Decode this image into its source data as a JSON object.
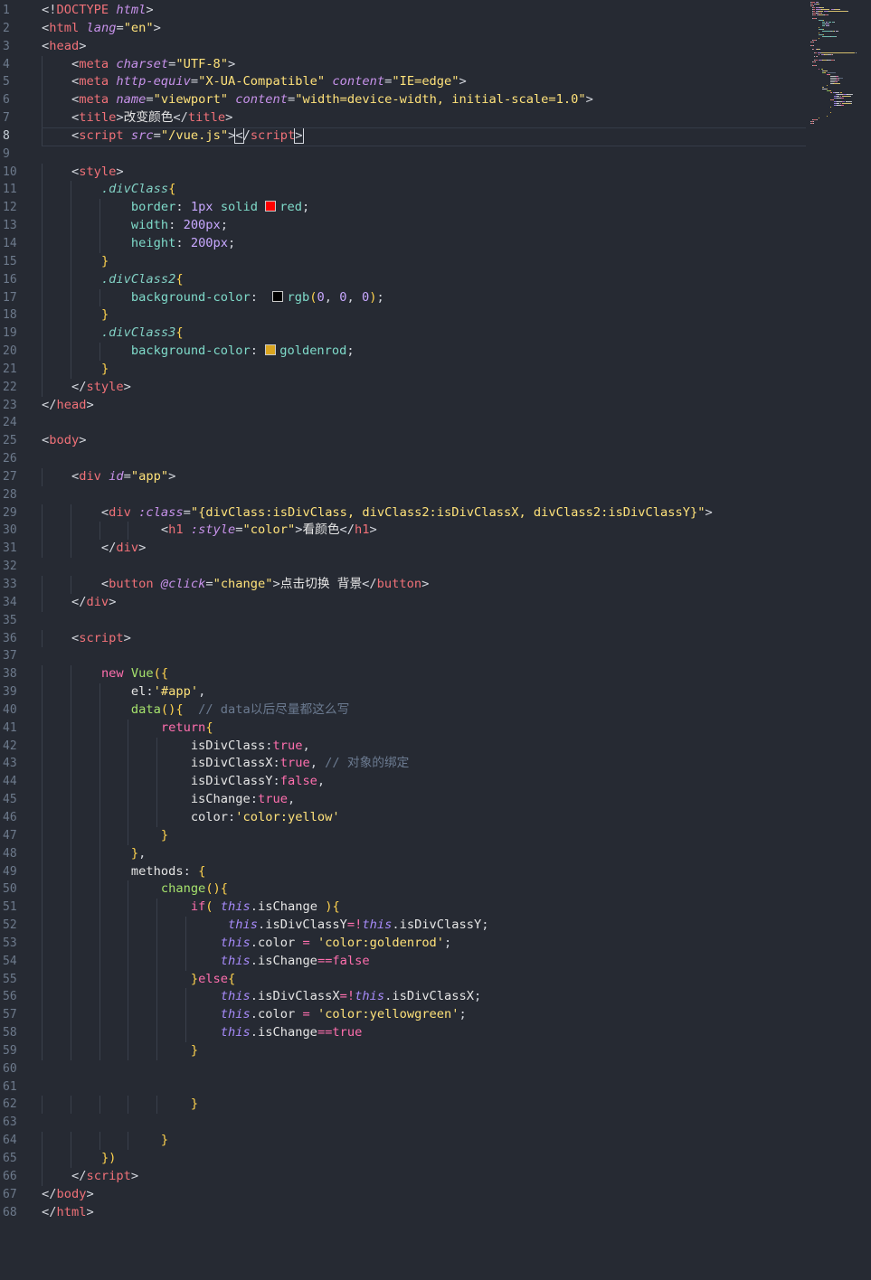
{
  "editor": {
    "active_line": 8,
    "colors": {
      "background": "#262a33",
      "red": "#ff0000",
      "black": "#000000",
      "goldenrod": "#daa520"
    },
    "lines": [
      [
        [
          "p",
          "<!"
        ],
        [
          "tag",
          "DOCTYPE"
        ],
        [
          "p",
          " "
        ],
        [
          "at",
          "html"
        ],
        [
          "p",
          ">"
        ]
      ],
      [
        [
          "p",
          "<"
        ],
        [
          "tag",
          "html"
        ],
        [
          "p",
          " "
        ],
        [
          "at",
          "lang"
        ],
        [
          "p",
          "="
        ],
        [
          "st",
          "\"en\""
        ],
        [
          "p",
          ">"
        ]
      ],
      [
        [
          "p",
          "<"
        ],
        [
          "tag",
          "head"
        ],
        [
          "p",
          ">"
        ]
      ],
      [
        [
          "p",
          "    <"
        ],
        [
          "tag",
          "meta"
        ],
        [
          "p",
          " "
        ],
        [
          "at",
          "charset"
        ],
        [
          "p",
          "="
        ],
        [
          "st",
          "\"UTF-8\""
        ],
        [
          "p",
          ">"
        ]
      ],
      [
        [
          "p",
          "    <"
        ],
        [
          "tag",
          "meta"
        ],
        [
          "p",
          " "
        ],
        [
          "at",
          "http-equiv"
        ],
        [
          "p",
          "="
        ],
        [
          "st",
          "\"X-UA-Compatible\""
        ],
        [
          "p",
          " "
        ],
        [
          "at",
          "content"
        ],
        [
          "p",
          "="
        ],
        [
          "st",
          "\"IE=edge\""
        ],
        [
          "p",
          ">"
        ]
      ],
      [
        [
          "p",
          "    <"
        ],
        [
          "tag",
          "meta"
        ],
        [
          "p",
          " "
        ],
        [
          "at",
          "name"
        ],
        [
          "p",
          "="
        ],
        [
          "st",
          "\"viewport\""
        ],
        [
          "p",
          " "
        ],
        [
          "at",
          "content"
        ],
        [
          "p",
          "="
        ],
        [
          "st",
          "\"width=device-width, initial-scale=1.0\""
        ],
        [
          "p",
          ">"
        ]
      ],
      [
        [
          "p",
          "    <"
        ],
        [
          "tag",
          "title"
        ],
        [
          "p",
          ">"
        ],
        [
          "id",
          "改变颜色"
        ],
        [
          "p",
          "</"
        ],
        [
          "tag",
          "title"
        ],
        [
          "p",
          ">"
        ]
      ],
      [
        [
          "p",
          "    <"
        ],
        [
          "tag",
          "script"
        ],
        [
          "p",
          " "
        ],
        [
          "at",
          "src"
        ],
        [
          "p",
          "="
        ],
        [
          "st",
          "\"/vue.js\""
        ],
        [
          "p",
          ">"
        ],
        [
          "p",
          "<"
        ],
        [
          "p",
          "/"
        ],
        [
          "tag",
          "script"
        ],
        [
          "p",
          ">"
        ]
      ],
      [],
      [
        [
          "p",
          "    <"
        ],
        [
          "tag",
          "style"
        ],
        [
          "p",
          ">"
        ]
      ],
      [
        [
          "p",
          "        "
        ],
        [
          "sel",
          ".divClass"
        ],
        [
          "br",
          "{"
        ]
      ],
      [
        [
          "p",
          "            "
        ],
        [
          "pr",
          "border"
        ],
        [
          "p",
          ": "
        ],
        [
          "num",
          "1px"
        ],
        [
          "p",
          " "
        ],
        [
          "pr",
          "solid"
        ],
        [
          "p",
          " "
        ],
        [
          "sw",
          "red"
        ],
        [
          "pr",
          "red"
        ],
        [
          "p",
          ";"
        ]
      ],
      [
        [
          "p",
          "            "
        ],
        [
          "pr",
          "width"
        ],
        [
          "p",
          ": "
        ],
        [
          "num",
          "200px"
        ],
        [
          "p",
          ";"
        ]
      ],
      [
        [
          "p",
          "            "
        ],
        [
          "pr",
          "height"
        ],
        [
          "p",
          ": "
        ],
        [
          "num",
          "200px"
        ],
        [
          "p",
          ";"
        ]
      ],
      [
        [
          "p",
          "        "
        ],
        [
          "br",
          "}"
        ]
      ],
      [
        [
          "p",
          "        "
        ],
        [
          "sel",
          ".divClass2"
        ],
        [
          "br",
          "{"
        ]
      ],
      [
        [
          "p",
          "            "
        ],
        [
          "pr",
          "background-color"
        ],
        [
          "p",
          ":  "
        ],
        [
          "sw",
          "black"
        ],
        [
          "pr",
          "rgb"
        ],
        [
          "br",
          "("
        ],
        [
          "num",
          "0"
        ],
        [
          "p",
          ", "
        ],
        [
          "num",
          "0"
        ],
        [
          "p",
          ", "
        ],
        [
          "num",
          "0"
        ],
        [
          "br",
          ")"
        ],
        [
          "p",
          ";"
        ]
      ],
      [
        [
          "p",
          "        "
        ],
        [
          "br",
          "}"
        ]
      ],
      [
        [
          "p",
          "        "
        ],
        [
          "sel",
          ".divClass3"
        ],
        [
          "br",
          "{"
        ]
      ],
      [
        [
          "p",
          "            "
        ],
        [
          "pr",
          "background-color"
        ],
        [
          "p",
          ": "
        ],
        [
          "sw",
          "goldenrod"
        ],
        [
          "pr",
          "goldenrod"
        ],
        [
          "p",
          ";"
        ]
      ],
      [
        [
          "p",
          "        "
        ],
        [
          "br",
          "}"
        ]
      ],
      [
        [
          "p",
          "    </"
        ],
        [
          "tag",
          "style"
        ],
        [
          "p",
          ">"
        ]
      ],
      [
        [
          "p",
          "</"
        ],
        [
          "tag",
          "head"
        ],
        [
          "p",
          ">"
        ]
      ],
      [],
      [
        [
          "p",
          "<"
        ],
        [
          "tag",
          "body"
        ],
        [
          "p",
          ">"
        ]
      ],
      [],
      [
        [
          "p",
          "    <"
        ],
        [
          "tag",
          "div"
        ],
        [
          "p",
          " "
        ],
        [
          "at",
          "id"
        ],
        [
          "p",
          "="
        ],
        [
          "st",
          "\"app\""
        ],
        [
          "p",
          ">"
        ]
      ],
      [],
      [
        [
          "p",
          "        <"
        ],
        [
          "tag",
          "div"
        ],
        [
          "p",
          " "
        ],
        [
          "at",
          ":class"
        ],
        [
          "p",
          "="
        ],
        [
          "st",
          "\"{divClass:isDivClass, divClass2:isDivClassX, divClass2:isDivClassY}\""
        ],
        [
          "p",
          ">"
        ]
      ],
      [
        [
          "p",
          "                <"
        ],
        [
          "tag",
          "h1"
        ],
        [
          "p",
          " "
        ],
        [
          "at",
          ":style"
        ],
        [
          "p",
          "="
        ],
        [
          "st",
          "\"color\""
        ],
        [
          "p",
          ">"
        ],
        [
          "id",
          "看颜色"
        ],
        [
          "p",
          "</"
        ],
        [
          "tag",
          "h1"
        ],
        [
          "p",
          ">"
        ]
      ],
      [
        [
          "p",
          "        </"
        ],
        [
          "tag",
          "div"
        ],
        [
          "p",
          ">"
        ]
      ],
      [],
      [
        [
          "p",
          "        <"
        ],
        [
          "tag",
          "button"
        ],
        [
          "p",
          " "
        ],
        [
          "at",
          "@click"
        ],
        [
          "p",
          "="
        ],
        [
          "st",
          "\"change\""
        ],
        [
          "p",
          ">"
        ],
        [
          "id",
          "点击切换 背景"
        ],
        [
          "p",
          "</"
        ],
        [
          "tag",
          "button"
        ],
        [
          "p",
          ">"
        ]
      ],
      [
        [
          "p",
          "    </"
        ],
        [
          "tag",
          "div"
        ],
        [
          "p",
          ">"
        ]
      ],
      [],
      [
        [
          "p",
          "    <"
        ],
        [
          "tag",
          "script"
        ],
        [
          "p",
          ">"
        ]
      ],
      [],
      [
        [
          "p",
          "        "
        ],
        [
          "kw",
          "new"
        ],
        [
          "p",
          " "
        ],
        [
          "fn",
          "Vue"
        ],
        [
          "br",
          "({"
        ]
      ],
      [
        [
          "p",
          "            "
        ],
        [
          "id",
          "el"
        ],
        [
          "p",
          ":"
        ],
        [
          "st",
          "'#app'"
        ],
        [
          "p",
          ","
        ]
      ],
      [
        [
          "p",
          "            "
        ],
        [
          "fn",
          "data"
        ],
        [
          "br",
          "(){"
        ],
        [
          "p",
          "  "
        ],
        [
          "cm",
          "// data以后尽量都这么写"
        ]
      ],
      [
        [
          "p",
          "                "
        ],
        [
          "kw",
          "return"
        ],
        [
          "br",
          "{"
        ]
      ],
      [
        [
          "p",
          "                    "
        ],
        [
          "id",
          "isDivClass"
        ],
        [
          "p",
          ":"
        ],
        [
          "bool",
          "true"
        ],
        [
          "p",
          ","
        ]
      ],
      [
        [
          "p",
          "                    "
        ],
        [
          "id",
          "isDivClassX"
        ],
        [
          "p",
          ":"
        ],
        [
          "bool",
          "true"
        ],
        [
          "p",
          ", "
        ],
        [
          "cm",
          "// 对象的绑定"
        ]
      ],
      [
        [
          "p",
          "                    "
        ],
        [
          "id",
          "isDivClassY"
        ],
        [
          "p",
          ":"
        ],
        [
          "bool",
          "false"
        ],
        [
          "p",
          ","
        ]
      ],
      [
        [
          "p",
          "                    "
        ],
        [
          "id",
          "isChange"
        ],
        [
          "p",
          ":"
        ],
        [
          "bool",
          "true"
        ],
        [
          "p",
          ","
        ]
      ],
      [
        [
          "p",
          "                    "
        ],
        [
          "id",
          "color"
        ],
        [
          "p",
          ":"
        ],
        [
          "st",
          "'color:yellow'"
        ]
      ],
      [
        [
          "p",
          "                "
        ],
        [
          "br",
          "}"
        ]
      ],
      [
        [
          "p",
          "            "
        ],
        [
          "br",
          "}"
        ],
        [
          "p",
          ","
        ]
      ],
      [
        [
          "p",
          "            "
        ],
        [
          "id",
          "methods"
        ],
        [
          "p",
          ": "
        ],
        [
          "br",
          "{"
        ]
      ],
      [
        [
          "p",
          "                "
        ],
        [
          "fn",
          "change"
        ],
        [
          "br",
          "(){"
        ]
      ],
      [
        [
          "p",
          "                    "
        ],
        [
          "kw",
          "if"
        ],
        [
          "br",
          "("
        ],
        [
          "p",
          " "
        ],
        [
          "th",
          "this"
        ],
        [
          "p",
          "."
        ],
        [
          "id",
          "isChange"
        ],
        [
          "p",
          " "
        ],
        [
          "br",
          ")"
        ],
        [
          "br",
          "{"
        ]
      ],
      [
        [
          "p",
          "                         "
        ],
        [
          "th",
          "this"
        ],
        [
          "p",
          "."
        ],
        [
          "id",
          "isDivClassY"
        ],
        [
          "kw",
          "=!"
        ],
        [
          "th",
          "this"
        ],
        [
          "p",
          "."
        ],
        [
          "id",
          "isDivClassY"
        ],
        [
          "p",
          ";"
        ]
      ],
      [
        [
          "p",
          "                        "
        ],
        [
          "th",
          "this"
        ],
        [
          "p",
          "."
        ],
        [
          "id",
          "color"
        ],
        [
          "p",
          " "
        ],
        [
          "kw",
          "="
        ],
        [
          "p",
          " "
        ],
        [
          "st",
          "'color:goldenrod'"
        ],
        [
          "p",
          ";"
        ]
      ],
      [
        [
          "p",
          "                        "
        ],
        [
          "th",
          "this"
        ],
        [
          "p",
          "."
        ],
        [
          "id",
          "isChange"
        ],
        [
          "kw",
          "=="
        ],
        [
          "bool",
          "false"
        ]
      ],
      [
        [
          "p",
          "                    "
        ],
        [
          "br",
          "}"
        ],
        [
          "kw",
          "else"
        ],
        [
          "br",
          "{"
        ]
      ],
      [
        [
          "p",
          "                        "
        ],
        [
          "th",
          "this"
        ],
        [
          "p",
          "."
        ],
        [
          "id",
          "isDivClassX"
        ],
        [
          "kw",
          "=!"
        ],
        [
          "th",
          "this"
        ],
        [
          "p",
          "."
        ],
        [
          "id",
          "isDivClassX"
        ],
        [
          "p",
          ";"
        ]
      ],
      [
        [
          "p",
          "                        "
        ],
        [
          "th",
          "this"
        ],
        [
          "p",
          "."
        ],
        [
          "id",
          "color"
        ],
        [
          "p",
          " "
        ],
        [
          "kw",
          "="
        ],
        [
          "p",
          " "
        ],
        [
          "st",
          "'color:yellowgreen'"
        ],
        [
          "p",
          ";"
        ]
      ],
      [
        [
          "p",
          "                        "
        ],
        [
          "th",
          "this"
        ],
        [
          "p",
          "."
        ],
        [
          "id",
          "isChange"
        ],
        [
          "kw",
          "=="
        ],
        [
          "bool",
          "true"
        ]
      ],
      [
        [
          "p",
          "                    "
        ],
        [
          "br",
          "}"
        ]
      ],
      [],
      [],
      [
        [
          "p",
          "                    "
        ],
        [
          "br",
          "}"
        ]
      ],
      [],
      [
        [
          "p",
          "                "
        ],
        [
          "br",
          "}"
        ]
      ],
      [
        [
          "p",
          "        "
        ],
        [
          "br",
          "})"
        ]
      ],
      [
        [
          "p",
          "    </"
        ],
        [
          "tag",
          "script"
        ],
        [
          "p",
          ">"
        ]
      ],
      [
        [
          "p",
          "</"
        ],
        [
          "tag",
          "body"
        ],
        [
          "p",
          ">"
        ]
      ],
      [
        [
          "p",
          "</"
        ],
        [
          "tag",
          "html"
        ],
        [
          "p",
          ">"
        ]
      ]
    ]
  }
}
